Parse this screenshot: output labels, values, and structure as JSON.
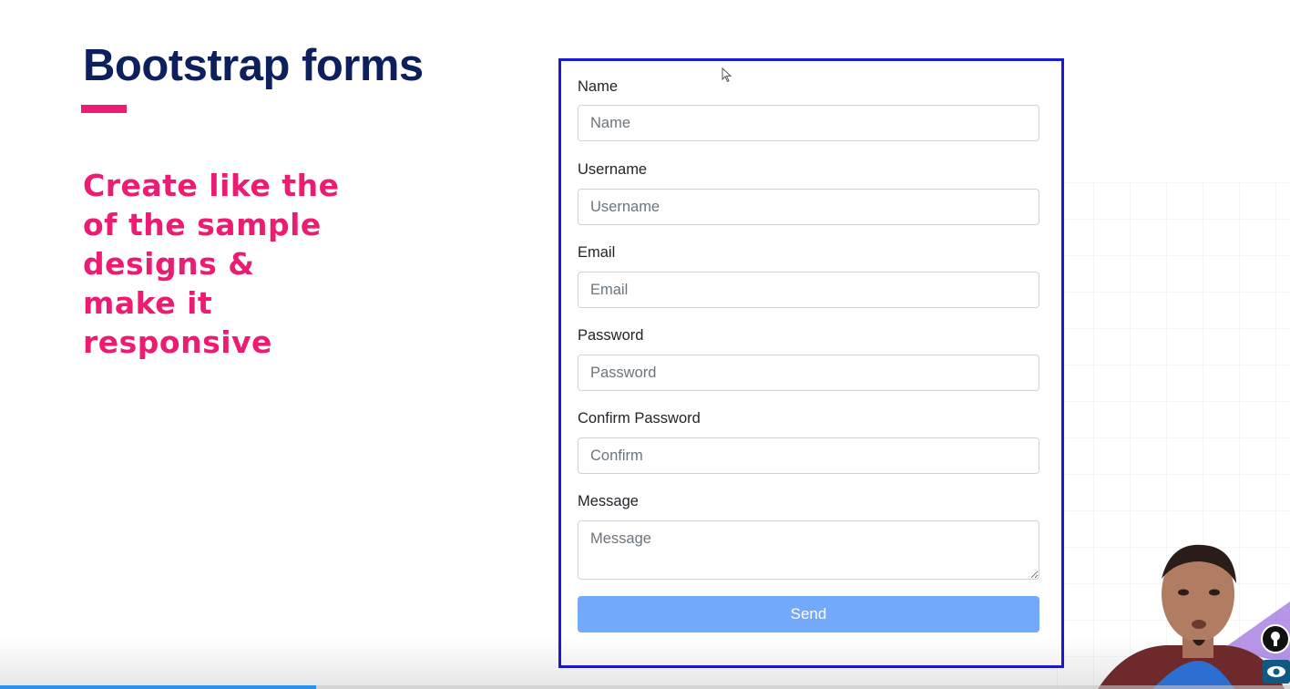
{
  "slide": {
    "title": "Bootstrap forms",
    "instruction": "Create like the of the sample designs & make it responsive",
    "accent_color": "#ec1c72",
    "title_color": "#0d1f5c"
  },
  "form": {
    "border_color": "#1a1ad6",
    "fields": [
      {
        "label": "Name",
        "placeholder": "Name"
      },
      {
        "label": "Username",
        "placeholder": "Username"
      },
      {
        "label": "Email",
        "placeholder": "Email"
      },
      {
        "label": "Password",
        "placeholder": "Password"
      },
      {
        "label": "Confirm Password",
        "placeholder": "Confirm"
      }
    ],
    "message": {
      "label": "Message",
      "placeholder": "Message"
    },
    "send_label": "Send",
    "send_color": "#72a9fb"
  },
  "video": {
    "progress_fraction": 0.245,
    "progress_color": "#2a92e8",
    "overlay_icons": [
      "keyhole-badge-icon",
      "eye-icon"
    ]
  }
}
